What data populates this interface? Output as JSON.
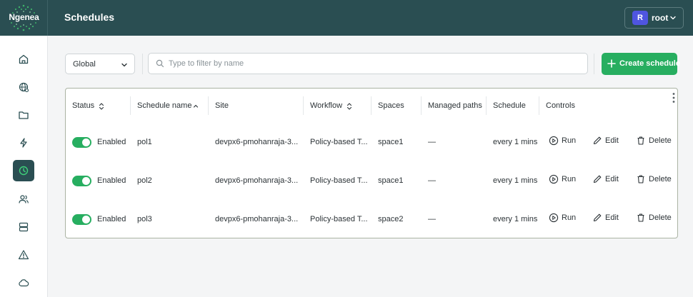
{
  "brand": {
    "logo_text": "Ngenea"
  },
  "header": {
    "title": "Schedules"
  },
  "user": {
    "initial": "R",
    "name": "root"
  },
  "sidebar": {
    "items": [
      {
        "name": "home",
        "icon": "home-icon"
      },
      {
        "name": "sites",
        "icon": "globe-network-icon"
      },
      {
        "name": "files",
        "icon": "folder-icon"
      },
      {
        "name": "actions",
        "icon": "lightning-icon"
      },
      {
        "name": "schedules",
        "icon": "clock-icon",
        "active": true
      },
      {
        "name": "users",
        "icon": "users-icon"
      },
      {
        "name": "storage",
        "icon": "server-icon"
      },
      {
        "name": "alerts",
        "icon": "warning-icon"
      },
      {
        "name": "cloud",
        "icon": "cloud-icon"
      }
    ]
  },
  "toolbar": {
    "scope_value": "Global",
    "search_placeholder": "Type to filter by name",
    "create_label": "Create schedule"
  },
  "table": {
    "columns": [
      "Status",
      "Schedule name",
      "Site",
      "Workflow",
      "Spaces",
      "Managed paths",
      "Schedule",
      "Controls"
    ],
    "rows": [
      {
        "status": "Enabled",
        "name": "pol1",
        "site": "devpx6-pmohanraja-3...",
        "workflow": "Policy-based T...",
        "spaces": "space1",
        "managed_paths": "—",
        "schedule": "every 1 mins"
      },
      {
        "status": "Enabled",
        "name": "pol2",
        "site": "devpx6-pmohanraja-3...",
        "workflow": "Policy-based T...",
        "spaces": "space1",
        "managed_paths": "—",
        "schedule": "every 1 mins"
      },
      {
        "status": "Enabled",
        "name": "pol3",
        "site": "devpx6-pmohanraja-3...",
        "workflow": "Policy-based T...",
        "spaces": "space2",
        "managed_paths": "—",
        "schedule": "every 1 mins"
      }
    ],
    "controls": {
      "run": "Run",
      "edit": "Edit",
      "delete": "Delete"
    }
  },
  "colors": {
    "topbar": "#2a4e52",
    "accent": "#27ae60",
    "avatar": "#4f55e0"
  }
}
